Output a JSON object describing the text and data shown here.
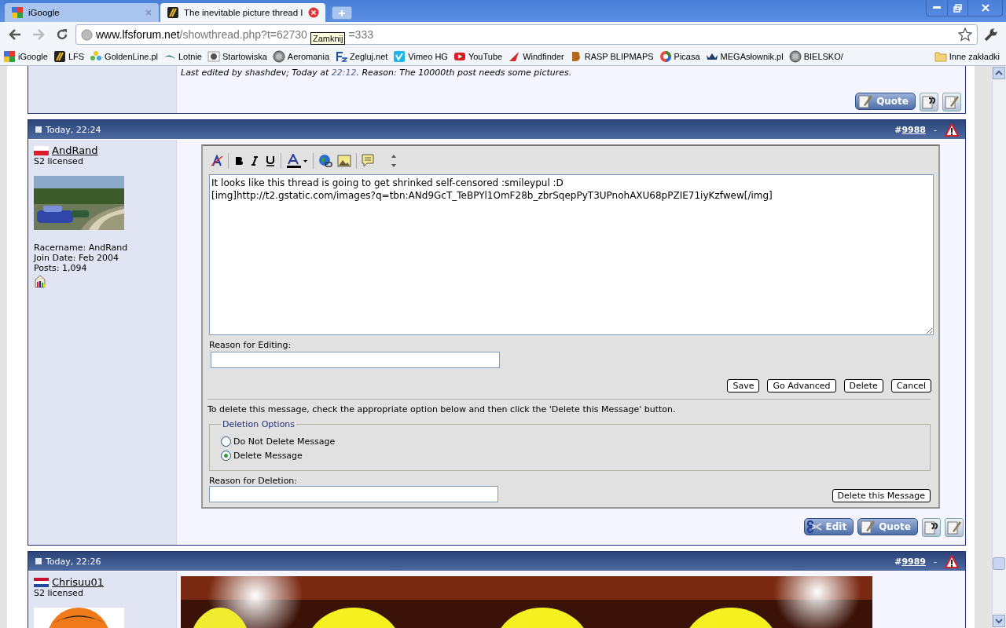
{
  "browser": {
    "tabs": [
      {
        "title": "iGoogle",
        "selected": false
      },
      {
        "title": "The inevitable picture thread I",
        "selected": true
      }
    ],
    "address": {
      "host": "www.lfsforum.net",
      "path": "/showthread.php?t=62730",
      "tooltip": "Zamknij",
      "tail": "=333"
    },
    "bookmarks": [
      "iGoogle",
      "LFS",
      "GoldenLine.pl",
      "Lotnie",
      "Startowiska",
      "Aeromania",
      "Zegluj.net",
      "Vimeo HG",
      "YouTube",
      "Windfinder",
      "RASP BLIPMAPS",
      "Picasa",
      "MEGAsłownik.pl",
      "BIELSKO/"
    ],
    "other_bookmarks": "Inne zakładki"
  },
  "previous_post": {
    "edit_note": {
      "prefix": "Last edited by shashdev; Today at ",
      "time": "22:12",
      "suffix": ". Reason: The 10000th post needs some pictures."
    },
    "quote_label": "Quote"
  },
  "posts": [
    {
      "date": "Today, 22:24",
      "number_prefix": "#",
      "number": "9988",
      "separator": "-",
      "user": {
        "name": "AndRand",
        "rank": "S2 licensed",
        "info": [
          "Racername: AndRand",
          "Join Date: Feb 2004",
          "Posts: 1,094"
        ]
      },
      "editor": {
        "text_lines": [
          "It looks like this thread is going to get shrinked self-censored :smileypul :D",
          "[img]http://t2.gstatic.com/images?q=tbn:ANd9GcT_TeBPYl1OmF28b_zbrSqepPyT3UPnohAXU68pPZIE71iyKzfwew[/img]"
        ],
        "reason_label": "Reason for Editing:",
        "buttons": [
          "Save",
          "Go Advanced",
          "Delete",
          "Cancel"
        ],
        "delete_note": "To delete this message, check the appropriate option below and then click the 'Delete this Message' button.",
        "deletion_legend": "Deletion Options",
        "options": [
          {
            "label": "Do Not Delete Message",
            "selected": false
          },
          {
            "label": "Delete Message",
            "selected": true
          }
        ],
        "deletion_reason_label": "Reason for Deletion:",
        "delete_button": "Delete this Message"
      },
      "edit_label": "Edit",
      "quote_label": "Quote"
    },
    {
      "date": "Today, 22:26",
      "number_prefix": "#",
      "number": "9989",
      "separator": "-",
      "user": {
        "name": "Chrisuu01",
        "rank": "S2 licensed"
      }
    }
  ]
}
